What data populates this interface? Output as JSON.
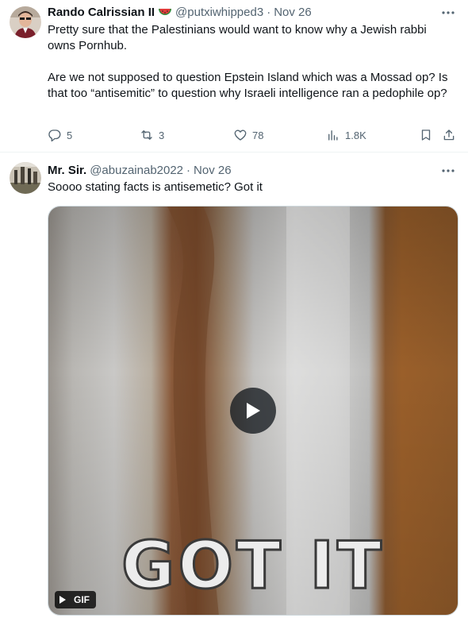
{
  "tweets": [
    {
      "name": "Rando Calrissian II",
      "handle": "@putxiwhipped3",
      "separator": "·",
      "date": "Nov 26",
      "emoji": "watermelon-icon",
      "paragraphs": [
        "Pretty sure that the Palestinians would want to know why a Jewish rabbi owns Pornhub.",
        "Are we not supposed to question Epstein Island which was a Mossad op? Is that too “antisemitic” to question why Israeli intelligence ran a pedophile op?"
      ],
      "actions": {
        "replies": "5",
        "reposts": "3",
        "likes": "78",
        "views": "1.8K"
      }
    },
    {
      "name": "Mr. Sir.",
      "handle": "@abuzainab2022",
      "separator": "·",
      "date": "Nov 26",
      "text": "Soooo stating facts is antisemetic? Got it",
      "media": {
        "caption": "GOT IT",
        "badge": "GIF"
      }
    }
  ],
  "colors": {
    "text": "#0f1419",
    "secondary": "#536471",
    "border": "#eff3f4"
  }
}
